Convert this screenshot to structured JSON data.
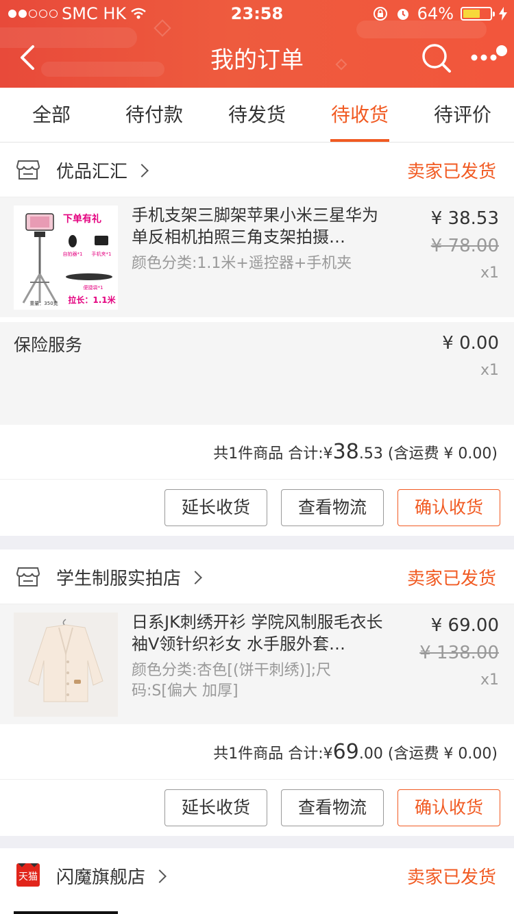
{
  "status_bar": {
    "carrier": "SMC HK",
    "time": "23:58",
    "battery": "64%",
    "battery_level": 0.64
  },
  "header": {
    "title": "我的订单",
    "colors": {
      "brand": "#ec5140",
      "accent": "#f15a22"
    }
  },
  "tabs": [
    {
      "label": "全部"
    },
    {
      "label": "待付款"
    },
    {
      "label": "待发货"
    },
    {
      "label": "待收货"
    },
    {
      "label": "待评价"
    }
  ],
  "active_tab": "待收货",
  "orders": [
    {
      "shop": "优品汇汇",
      "shop_icon": "store-icon",
      "status": "卖家已发货",
      "item": {
        "title": "手机支架三脚架苹果小米三星华为单反相机拍照三角支架拍摄…",
        "sku": "颜色分类:1.1米+遥控器+手机夹",
        "price": "¥ 38.53",
        "original_price": "¥ 78.00",
        "qty": "x1",
        "thumb_text": {
          "promo": "下单有礼",
          "remote": "自拍器*1",
          "clip": "手机夹*1",
          "bag": "便捷袋*1",
          "weight": "重量：350克",
          "length": "拉长：1.1米"
        }
      },
      "service": {
        "title": "保险服务",
        "price": "¥ 0.00",
        "qty": "x1"
      },
      "summary": {
        "prefix": "共1件商品 合计:¥",
        "int": "38",
        "dec": ".53",
        "suffix": "(含运费 ¥ 0.00)"
      },
      "buttons": {
        "extend": "延长收货",
        "logistics": "查看物流",
        "confirm": "确认收货"
      }
    },
    {
      "shop": "学生制服实拍店",
      "shop_icon": "store-icon",
      "status": "卖家已发货",
      "item": {
        "title": "日系JK刺绣开衫 学院风制服毛衣长袖V领针织衫女 水手服外套…",
        "sku": "颜色分类:杏色[(饼干刺绣)];尺码:S[偏大 加厚]",
        "price": "¥ 69.00",
        "original_price": "¥ 138.00",
        "qty": "x1"
      },
      "summary": {
        "prefix": "共1件商品 合计:¥",
        "int": "69",
        "dec": ".00",
        "suffix": "(含运费 ¥ 0.00)"
      },
      "buttons": {
        "extend": "延长收货",
        "logistics": "查看物流",
        "confirm": "确认收货"
      }
    },
    {
      "shop": "闪魔旗舰店",
      "shop_icon": "tmall-icon",
      "tmall_badge": "天猫",
      "status": "卖家已发货"
    }
  ]
}
